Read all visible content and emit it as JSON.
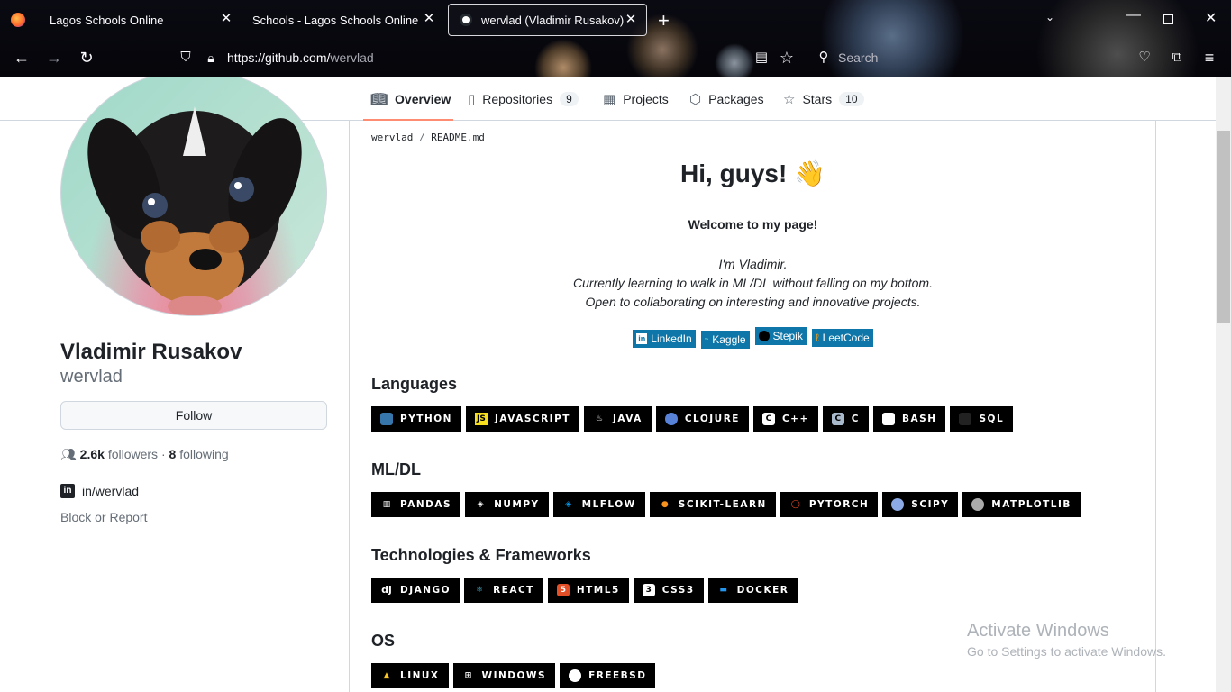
{
  "browser": {
    "tabs": [
      {
        "title": "Lagos Schools Online"
      },
      {
        "title": "Schools - Lagos Schools Online"
      },
      {
        "title": "wervlad (Vladimir Rusakov)"
      }
    ],
    "url_host": "https://github.com/",
    "url_path": "wervlad",
    "search_placeholder": "Search"
  },
  "nav": {
    "tabs": [
      {
        "label": "Overview",
        "icon": "book-icon"
      },
      {
        "label": "Repositories",
        "icon": "repo-icon",
        "count": "9"
      },
      {
        "label": "Projects",
        "icon": "table-icon"
      },
      {
        "label": "Packages",
        "icon": "package-icon"
      },
      {
        "label": "Stars",
        "icon": "star-icon",
        "count": "10"
      }
    ]
  },
  "profile": {
    "name": "Vladimir Rusakov",
    "login": "wervlad",
    "follow_label": "Follow",
    "followers": "2.6k",
    "followers_label": "followers",
    "following": "8",
    "following_label": "following",
    "linkedin": "in/wervlad",
    "block_label": "Block or Report"
  },
  "readme": {
    "owner": "wervlad",
    "file": "README.md",
    "heading": "Hi, guys! 👋",
    "welcome": "Welcome to my page!",
    "intro": [
      "I'm Vladimir.",
      "Currently learning to walk in ML/DL without falling on my bottom.",
      "Open to collaborating on interesting and innovative projects."
    ],
    "links": [
      "LinkedIn",
      "Kaggle",
      "Stepik",
      "LeetCode"
    ],
    "sections": [
      {
        "title": "Languages",
        "badges": [
          "PYTHON",
          "JAVASCRIPT",
          "JAVA",
          "CLOJURE",
          "C++",
          "C",
          "BASH",
          "SQL"
        ]
      },
      {
        "title": "ML/DL",
        "badges": [
          "PANDAS",
          "NUMPY",
          "MLFLOW",
          "SCIKIT-LEARN",
          "PYTORCH",
          "SCIPY",
          "MATPLOTLIB"
        ]
      },
      {
        "title": "Technologies & Frameworks",
        "badges": [
          "DJANGO",
          "REACT",
          "HTML5",
          "CSS3",
          "DOCKER"
        ]
      },
      {
        "title": "OS",
        "badges": [
          "LINUX",
          "WINDOWS",
          "FREEBSD"
        ]
      }
    ]
  },
  "watermark": {
    "title": "Activate Windows",
    "subtitle": "Go to Settings to activate Windows."
  }
}
